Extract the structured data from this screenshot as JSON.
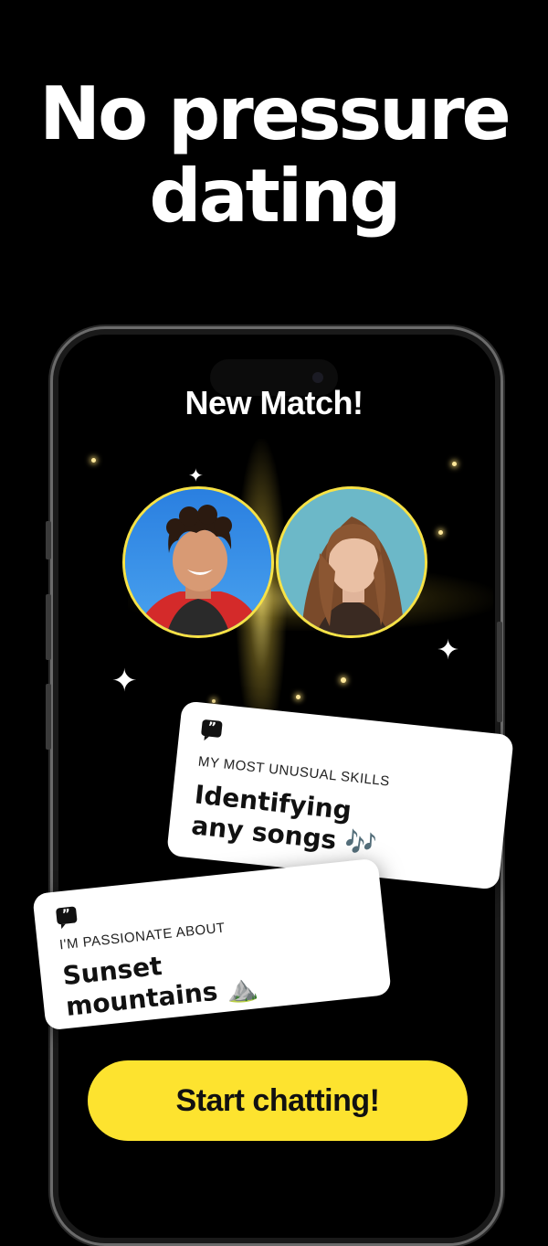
{
  "headline": {
    "line1": "No pressure",
    "line2": "dating"
  },
  "match": {
    "title": "New Match!"
  },
  "cards": [
    {
      "label": "MY MOST UNUSUAL SKILLS",
      "answer": "Identifying\nany songs",
      "emoji": "🎶"
    },
    {
      "label": "I'M PASSIONATE ABOUT",
      "answer": "Sunset\nmountains",
      "emoji": "⛰️"
    }
  ],
  "cta": {
    "label": "Start chatting!"
  },
  "colors": {
    "accent": "#fde32f",
    "avatar_ring": "#f7e246",
    "background": "#000000"
  }
}
